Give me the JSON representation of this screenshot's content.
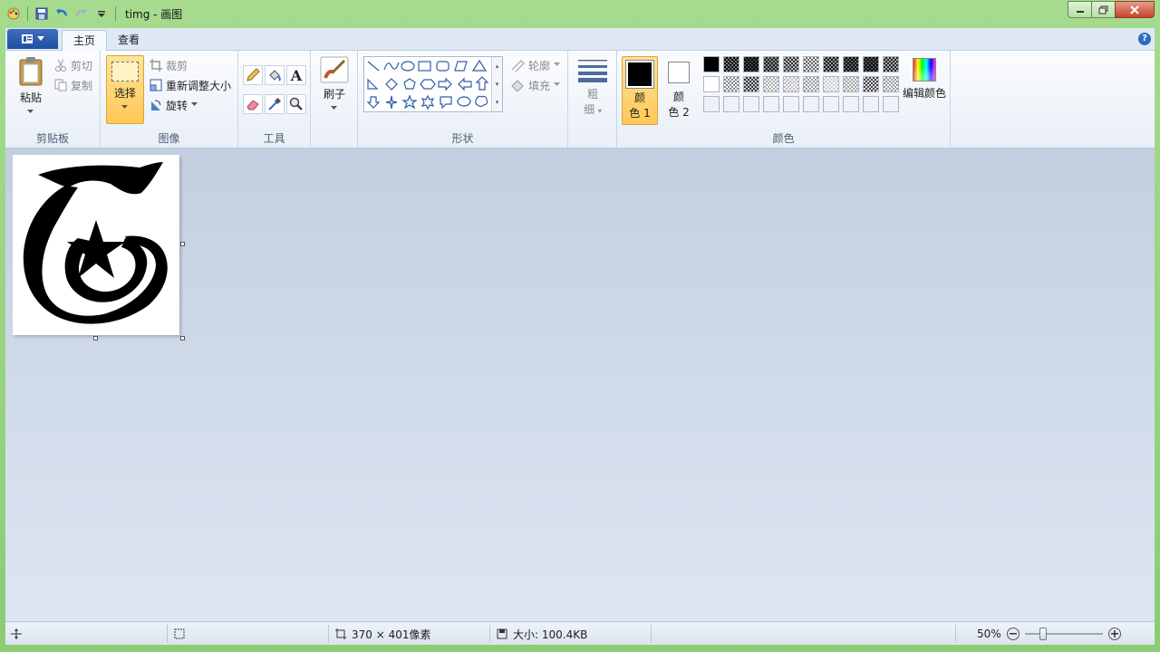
{
  "title": {
    "text": "timg - 画图"
  },
  "tabs": [
    {
      "label": "主页"
    },
    {
      "label": "查看"
    }
  ],
  "clipboard": {
    "paste": "粘贴",
    "cut": "剪切",
    "copy": "复制",
    "group": "剪贴板"
  },
  "image": {
    "select": "选择",
    "crop": "裁剪",
    "resize": "重新调整大小",
    "rotate": "旋转",
    "group": "图像"
  },
  "tools": {
    "group": "工具"
  },
  "brushes": {
    "label": "刷子"
  },
  "shapes": {
    "outline": "轮廓",
    "fill": "填充",
    "group": "形状"
  },
  "size": {
    "label_top": "粗",
    "label_bottom": "细"
  },
  "colors": {
    "color1_top": "颜",
    "color1_bottom": "色 1",
    "color2_top": "颜",
    "color2_bottom": "色 2",
    "edit": "编辑颜色",
    "group": "颜色",
    "color1_value": "#000000",
    "color2_value": "#ffffff"
  },
  "status": {
    "dimensions": "370 × 401像素",
    "filesize": "大小: 100.4KB",
    "zoom": "50%"
  }
}
